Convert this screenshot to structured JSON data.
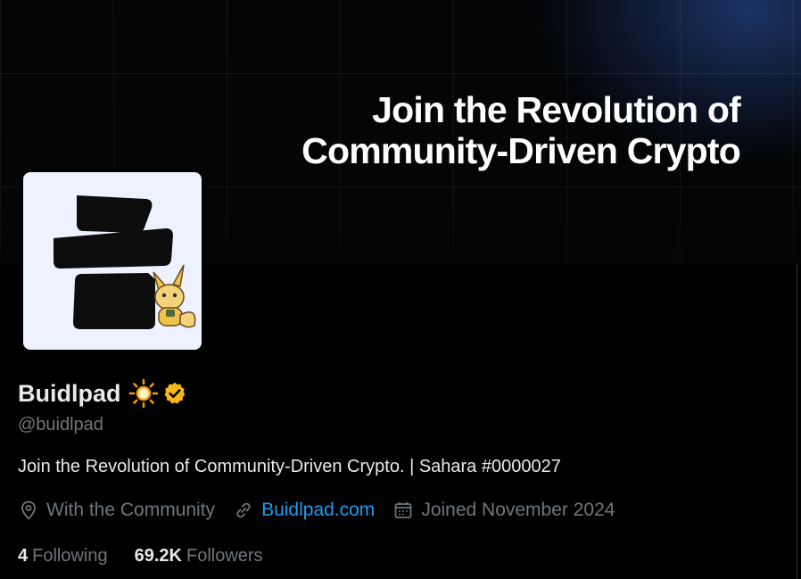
{
  "banner": {
    "headline_line1": "Join the Revolution of",
    "headline_line2": "Community-Driven Crypto",
    "accent": "#284b96"
  },
  "profile": {
    "name": "Buidlpad",
    "name_emoji_icon": "sun-icon",
    "verified_icon": "verified-badge-icon",
    "verified_color": "#f5b817",
    "handle": "@buidlpad",
    "bio": "Join the Revolution of Community-Driven Crypto. | Sahara #0000027",
    "location": "With the Community",
    "location_icon": "location-pin-icon",
    "website": "Buidlpad.com",
    "website_icon": "link-icon",
    "link_color": "#1d9bf0",
    "joined": "Joined November 2024",
    "joined_icon": "calendar-icon"
  },
  "stats": {
    "following_count": "4",
    "following_label": "Following",
    "followers_count": "69.2K",
    "followers_label": "Followers"
  }
}
